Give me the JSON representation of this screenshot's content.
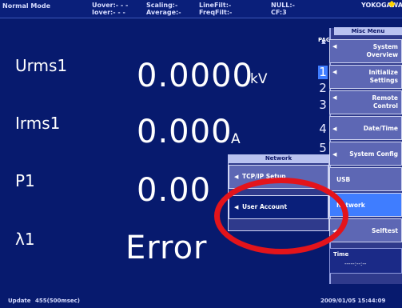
{
  "status_bar": {
    "mode": "Normal Mode",
    "uover": "Uover:- - -",
    "iover": "Iover:- - -",
    "scaling": "Scaling:-",
    "average": "Average:-",
    "line_filt": "LineFilt:-",
    "freq_filt": "FreqFilt:-",
    "null": "NULL:-",
    "cf": "CF:3",
    "brand": "YOKOGAWA"
  },
  "measurements": [
    {
      "label": "Urms1",
      "value": "0.0000",
      "unit": "kV"
    },
    {
      "label": "Irms1",
      "value": "0.000",
      "unit": "A"
    },
    {
      "label": "P1",
      "value": "0.00",
      "unit": ""
    },
    {
      "label": "λ1",
      "value": "Error",
      "unit": ""
    }
  ],
  "page_indicator": {
    "tag": "PAG",
    "pages": [
      "1",
      "2",
      "3",
      "4",
      "5"
    ],
    "active_page": "1"
  },
  "misc_menu": {
    "title": "Misc Menu",
    "items": [
      {
        "label_line1": "System",
        "label_line2": "Overview"
      },
      {
        "label_line1": "Initialize",
        "label_line2": "Settings"
      },
      {
        "label_line1": "Remote",
        "label_line2": "Control"
      },
      {
        "label_line1": "Date/Time",
        "label_line2": ""
      },
      {
        "label_line1": "System Config",
        "label_line2": ""
      },
      {
        "label_line1": "USB",
        "label_line2": ""
      },
      {
        "label_line1": "Network",
        "label_line2": ""
      },
      {
        "label_line1": "Selftest",
        "label_line2": ""
      }
    ],
    "selected": "Network",
    "time": {
      "label": "Time",
      "value": "-----:--:--"
    }
  },
  "network_menu": {
    "title": "Network",
    "items": [
      {
        "label": "TCP/IP Setup"
      },
      {
        "label": "User Account"
      }
    ],
    "highlighted": "User Account"
  },
  "bottom_bar": {
    "update": "Update",
    "update_count": "455(500msec)",
    "datetime": "2009/01/05 15:44:09"
  },
  "colors": {
    "background": "#071a6e",
    "menu_bg": "#5d67b4",
    "selected_item": "#3f7dff",
    "annotation": "#e3141b"
  }
}
